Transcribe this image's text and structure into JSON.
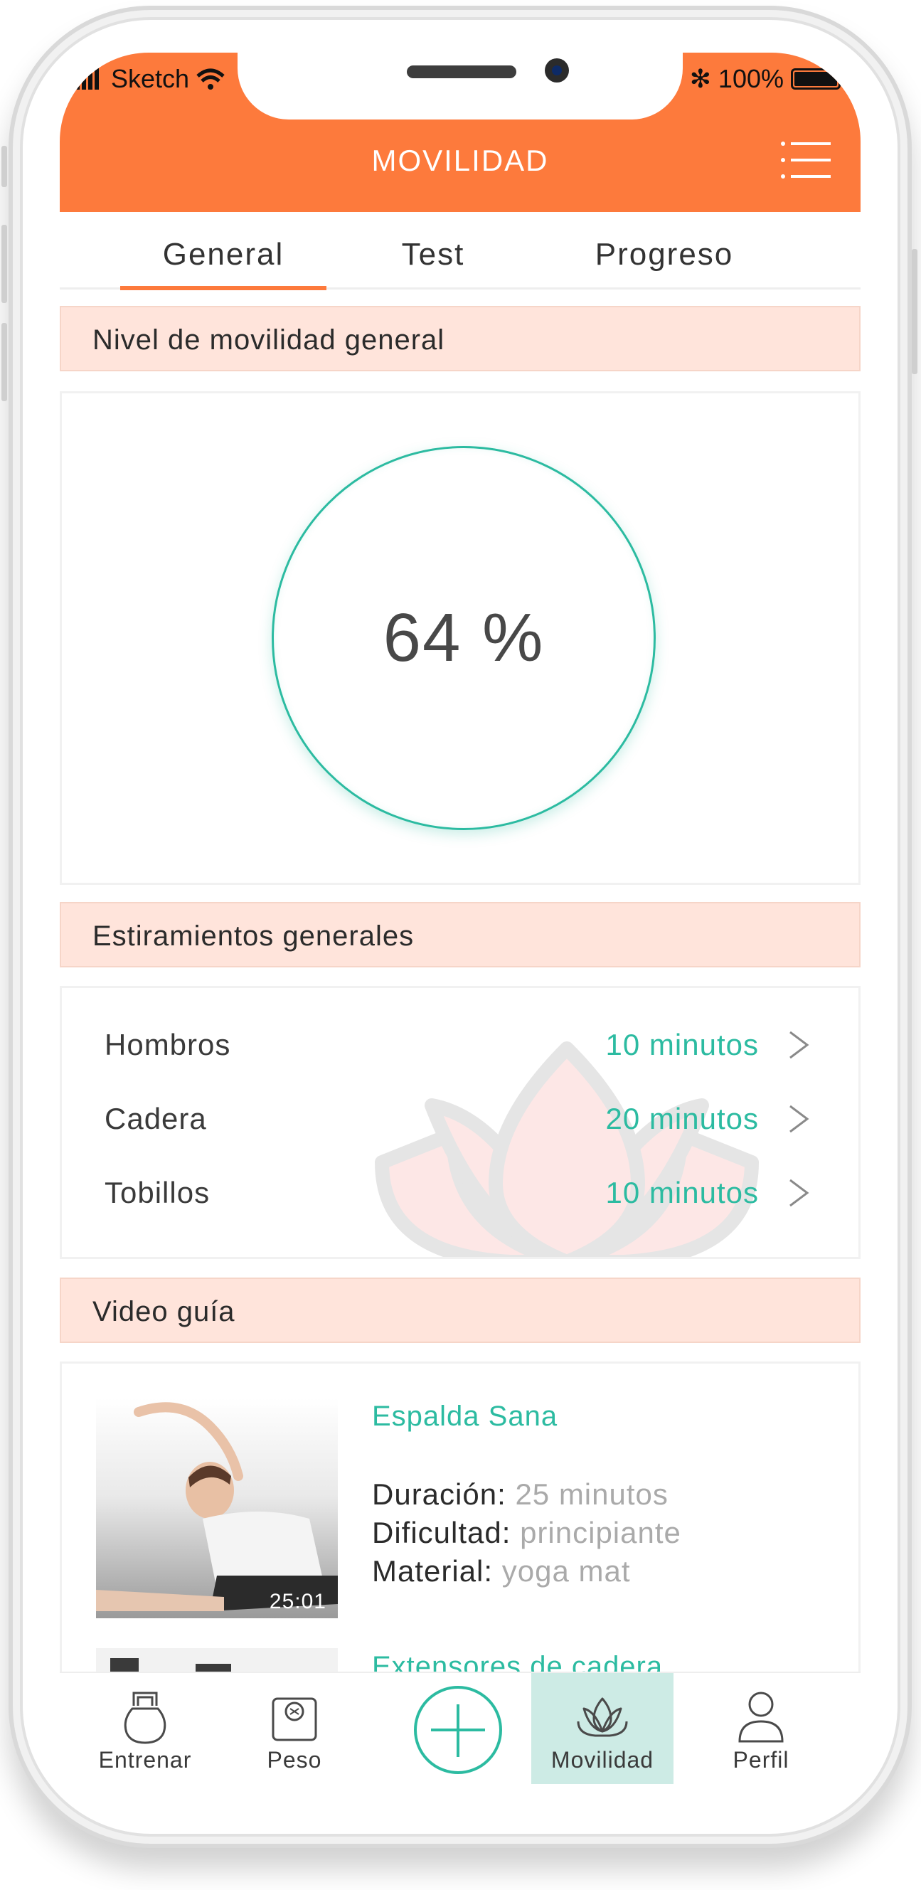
{
  "status_bar": {
    "carrier": "Sketch",
    "battery_text": "100%"
  },
  "header": {
    "title": "MOVILIDAD",
    "color": "#fd7a3c"
  },
  "tabs": [
    {
      "label": "General",
      "active": true
    },
    {
      "label": "Test",
      "active": false
    },
    {
      "label": "Progreso",
      "active": false
    }
  ],
  "mobility": {
    "section_title": "Nivel de movilidad general",
    "value_text": "64 %",
    "percent": 64
  },
  "stretches": {
    "section_title": "Estiramientos generales",
    "items": [
      {
        "name": "Hombros",
        "duration": "10 minutos"
      },
      {
        "name": "Cadera",
        "duration": "20 minutos"
      },
      {
        "name": "Tobillos",
        "duration": "10 minutos"
      }
    ]
  },
  "videos": {
    "section_title": "Video guía",
    "items": [
      {
        "title": "Espalda Sana",
        "time": "25:01",
        "duration_label": "Duración:",
        "duration": "25 minutos",
        "difficulty_label": "Dificultad:",
        "difficulty": "principiante",
        "material_label": "Material:",
        "material": "yoga mat"
      },
      {
        "title": "Extensores de cadera"
      }
    ]
  },
  "bottom_nav": [
    {
      "label": "Entrenar",
      "icon": "kettlebell-icon"
    },
    {
      "label": "Peso",
      "icon": "scale-icon"
    },
    {
      "label": "Movilidad",
      "icon": "lotus-icon",
      "active": true
    },
    {
      "label": "Perfil",
      "icon": "user-icon"
    }
  ],
  "colors": {
    "accent": "#fd7a3c",
    "teal": "#2cbba1",
    "section_bg": "#ffe4db",
    "active_nav_bg": "#cdebe5"
  }
}
